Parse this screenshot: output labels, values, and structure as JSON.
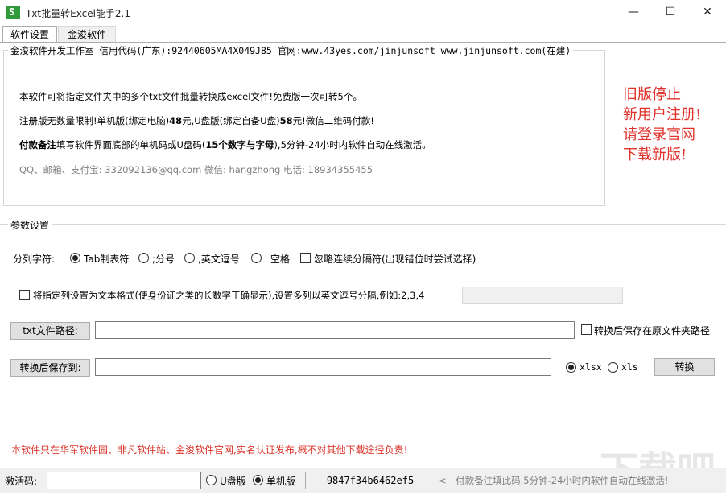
{
  "window": {
    "title": "Txt批量转Excel能手2.1",
    "app_icon_letter": "S",
    "controls": {
      "minimize": "—",
      "maximize": "☐",
      "close": "✕"
    }
  },
  "tabs": [
    {
      "label": "软件设置",
      "active": true
    },
    {
      "label": "金浚软件",
      "active": false
    }
  ],
  "info": {
    "group_title": "金浚软件开发工作室 信用代码(广东):92440605MA4X049J85 官网:www.43yes.com/jinjunsoft  www.jinjunsoft.com(在建)",
    "line1": "本软件可将指定文件夹中的多个txt文件批量转换成excel文件!免费版一次可转5个。",
    "line2_a": "注册版无数量限制!单机版(绑定电脑)",
    "line2_b": "48",
    "line2_c": "元,U盘版(绑定自备U盘)",
    "line2_d": "58",
    "line2_e": "元!微信二维码付款!",
    "line3_a": "付款备注",
    "line3_b": "填写软件界面底部的单机码或U盘码(",
    "line3_c": "15个数字与字母",
    "line3_d": "),5分钟-24小时内软件自动在线激活。",
    "line4": "QQ、邮箱、支付宝: 332092136@qq.com   微信: hangzhong   电话: 18934355455"
  },
  "notice": [
    "旧版停止",
    "新用户注册!",
    "请登录官网",
    "下载新版!"
  ],
  "params": {
    "group_title": "参数设置",
    "separator_label": "分列字符:",
    "options": [
      {
        "label": "Tab制表符",
        "selected": true
      },
      {
        "label": ";分号",
        "selected": false
      },
      {
        "label": ",英文逗号",
        "selected": false
      },
      {
        "label": "空格",
        "selected": false
      }
    ],
    "ignore_label": "忽略连续分隔符(出现错位时尝试选择)",
    "text_format_label": "将指定列设置为文本格式(使身份证之类的长数字正确显示),设置多列以英文逗号分隔,例如:2,3,4",
    "text_format_value": "",
    "txt_path_button": "txt文件路径:",
    "txt_path_value": "",
    "save_in_source_label": "转换后保存在原文件夹路径",
    "save_to_button": "转换后保存到:",
    "save_to_value": "",
    "format_options": [
      {
        "label": "xlsx",
        "selected": true
      },
      {
        "label": "xls",
        "selected": false
      }
    ],
    "convert_button": "转换"
  },
  "footer_notice": "本软件只在华军软件园、非凡软件站、金浚软件官网,实名认证发布,概不对其他下载途径负责!",
  "statusbar": {
    "activation_label": "激活码:",
    "activation_value": "",
    "usb_label": "U盘版",
    "usb_selected": false,
    "standalone_label": "单机版",
    "standalone_selected": true,
    "machine_code": "9847f34b6462ef5",
    "hint": "<—付款备注填此码,5分钟-24小时内软件自动在线激活!"
  },
  "watermark": "下载吧"
}
